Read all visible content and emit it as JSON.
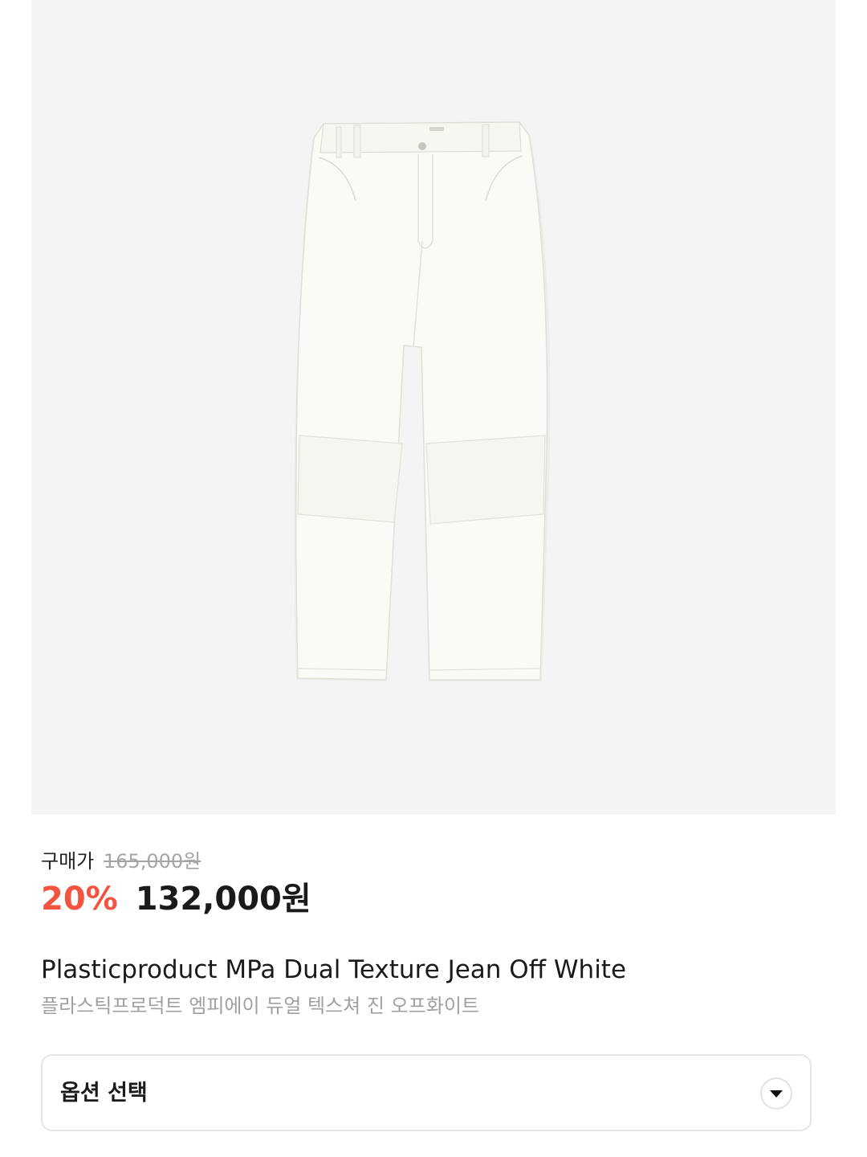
{
  "product": {
    "image_icon": "jeans-product-photo",
    "image_background": "#f4f4f4",
    "price_label": "구매가",
    "original_price": "165,000원",
    "discount_rate": "20%",
    "sale_price": "132,000원",
    "name_en": "Plasticproduct MPa Dual Texture Jean Off White",
    "name_ko": "플라스틱프로덕트 엠피에이 듀얼 텍스쳐 진 오프화이트"
  },
  "option": {
    "label": "옵션 선택",
    "icon": "chevron-down-icon"
  },
  "colors": {
    "discount": "#f2543f",
    "original_price": "#a5a5a5",
    "secondary_text": "#a0a0a0",
    "border": "#e6e6e6"
  }
}
